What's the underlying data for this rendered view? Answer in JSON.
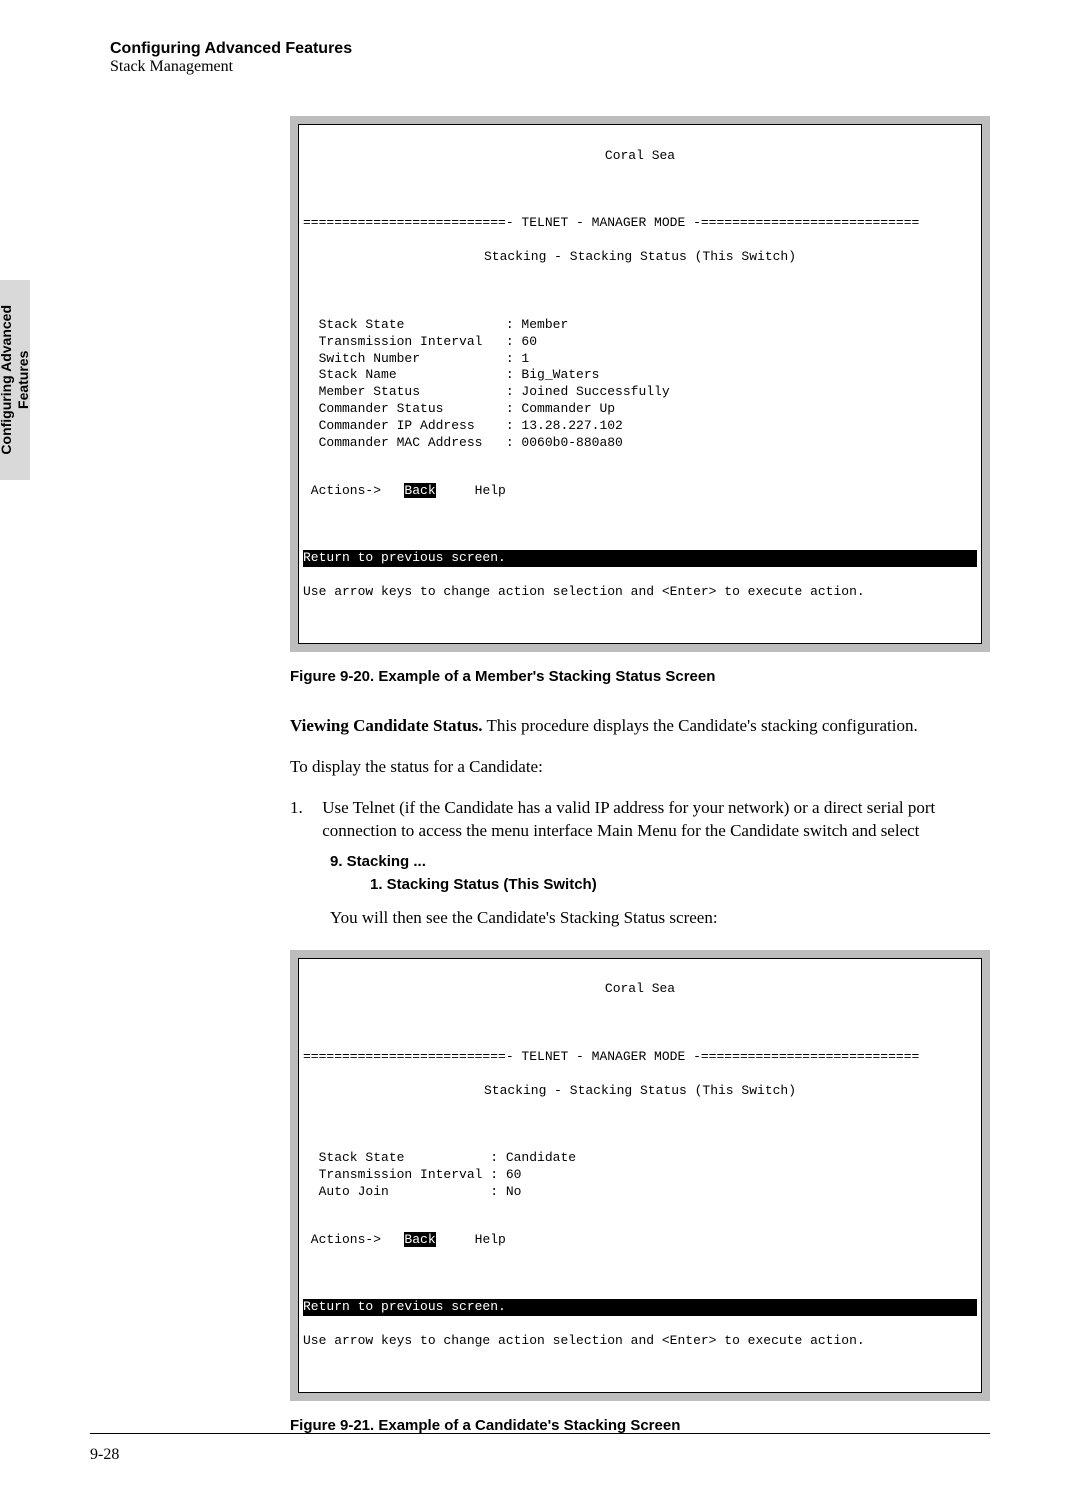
{
  "header": {
    "title": "Configuring Advanced Features",
    "subtitle": "Stack Management"
  },
  "side_tab": {
    "line1": "Configuring Advanced",
    "line2": "Features"
  },
  "terminal1": {
    "title": "Coral Sea",
    "mode_line": "==========================- TELNET - MANAGER MODE -============================",
    "subtitle": "Stacking - Stacking Status (This Switch)",
    "fields": [
      {
        "label": "Stack State",
        "value": "Member"
      },
      {
        "label": "Transmission Interval",
        "value": "60"
      },
      {
        "label": "Switch Number",
        "value": "1"
      },
      {
        "label": "Stack Name",
        "value": "Big_Waters"
      },
      {
        "label": "Member Status",
        "value": "Joined Successfully"
      },
      {
        "label": "Commander Status",
        "value": "Commander Up"
      },
      {
        "label": "Commander IP Address",
        "value": "13.28.227.102"
      },
      {
        "label": "Commander MAC Address",
        "value": "0060b0-880a80"
      }
    ],
    "actions_prefix": " Actions->   ",
    "back": "Back",
    "help": "Help",
    "status": "Return to previous screen.",
    "hint": "Use arrow keys to change action selection and <Enter> to execute action."
  },
  "caption1": "Figure 9-20.  Example of a Member's Stacking Status Screen",
  "para1_lead": "Viewing Candidate Status.",
  "para1_rest": " This procedure displays the Candidate's stacking configuration.",
  "para2": "To display the status for a Candidate:",
  "step1_num": "1.",
  "step1": "Use Telnet (if the Candidate has a valid IP address for your network) or a direct serial port connection to access the menu interface Main Menu for the Candidate switch and select",
  "menu1": "9. Stacking ...",
  "menu2": "1. Stacking Status (This Switch)",
  "step1_followup": "You will then see the Candidate's Stacking Status screen:",
  "terminal2": {
    "title": "Coral Sea",
    "mode_line": "==========================- TELNET - MANAGER MODE -============================",
    "subtitle": "Stacking - Stacking Status (This Switch)",
    "fields": [
      {
        "label": "Stack State",
        "value": "Candidate"
      },
      {
        "label": "Transmission Interval",
        "value": "60"
      },
      {
        "label": "Auto Join",
        "value": "No"
      }
    ],
    "actions_prefix": " Actions->   ",
    "back": "Back",
    "help": "Help",
    "status": "Return to previous screen.",
    "hint": "Use arrow keys to change action selection and <Enter> to execute action."
  },
  "caption2": "Figure 9-21.  Example of a Candidate's Stacking Screen",
  "page_number": "9-28"
}
